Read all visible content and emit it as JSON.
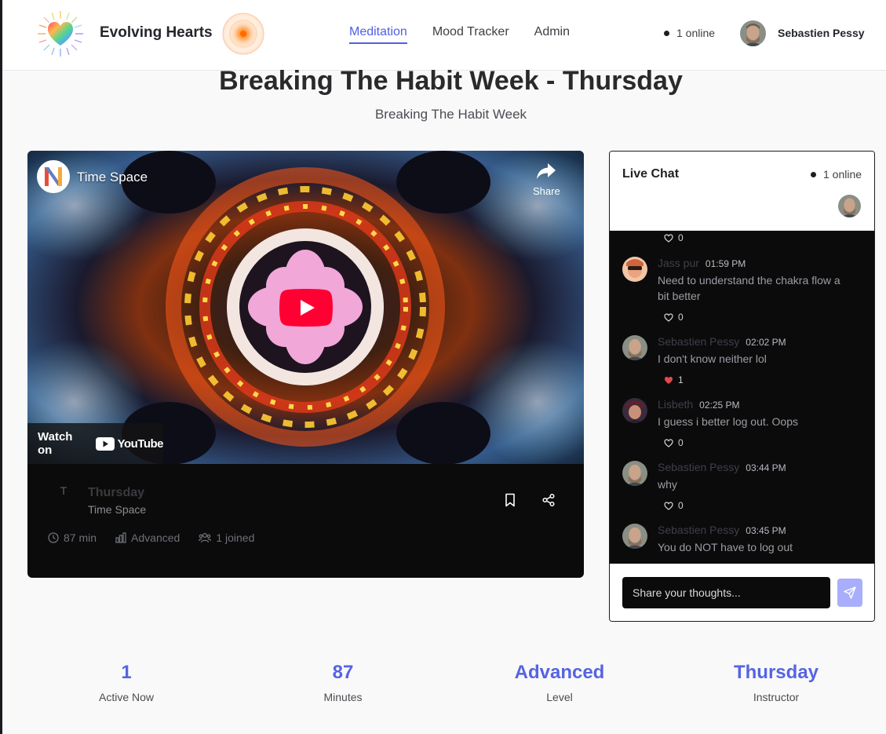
{
  "header": {
    "brand_name": "Evolving Hearts",
    "nav": [
      {
        "label": "Meditation",
        "active": true
      },
      {
        "label": "Mood Tracker",
        "active": false
      },
      {
        "label": "Admin",
        "active": false
      }
    ],
    "online_text": "1 online",
    "user_name": "Sebastien Pessy"
  },
  "page": {
    "title": "Breaking The Habit Week - Thursday",
    "subtitle": "Breaking The Habit Week"
  },
  "video": {
    "embed_title": "Time Space",
    "share_label": "Share",
    "watch_on_label": "Watch on",
    "youtube_word": "YouTube",
    "avatar_initial": "T",
    "session_title": "Thursday",
    "session_channel": "Time Space",
    "duration": "87 min",
    "level": "Advanced",
    "joined": "1 joined"
  },
  "chat": {
    "title": "Live Chat",
    "online_text": "1 online",
    "top_likes": "0",
    "messages": [
      {
        "author": "Jass pur",
        "time": "01:59 PM",
        "text": "Need to understand the chakra flow a bit better",
        "likes": "0",
        "liked": false
      },
      {
        "author": "Sebastien Pessy",
        "time": "02:02 PM",
        "text": "I don't know neither lol",
        "likes": "1",
        "liked": true
      },
      {
        "author": "Lisbeth",
        "time": "02:25 PM",
        "text": "I guess i better log out. Oops",
        "likes": "0",
        "liked": false
      },
      {
        "author": "Sebastien Pessy",
        "time": "03:44 PM",
        "text": "why",
        "likes": "0",
        "liked": false
      },
      {
        "author": "Sebastien Pessy",
        "time": "03:45 PM",
        "text": "You do NOT have to log out",
        "likes": "0",
        "liked": false
      }
    ],
    "input_placeholder": "Share your thoughts..."
  },
  "stats": [
    {
      "value": "1",
      "label": "Active Now"
    },
    {
      "value": "87",
      "label": "Minutes"
    },
    {
      "value": "Advanced",
      "label": "Level"
    },
    {
      "value": "Thursday",
      "label": "Instructor"
    }
  ],
  "colors": {
    "accent": "#4f5fe6",
    "stat_value": "#5564e3",
    "send_button": "#a8aefc",
    "heart_liked": "#e5484d"
  }
}
